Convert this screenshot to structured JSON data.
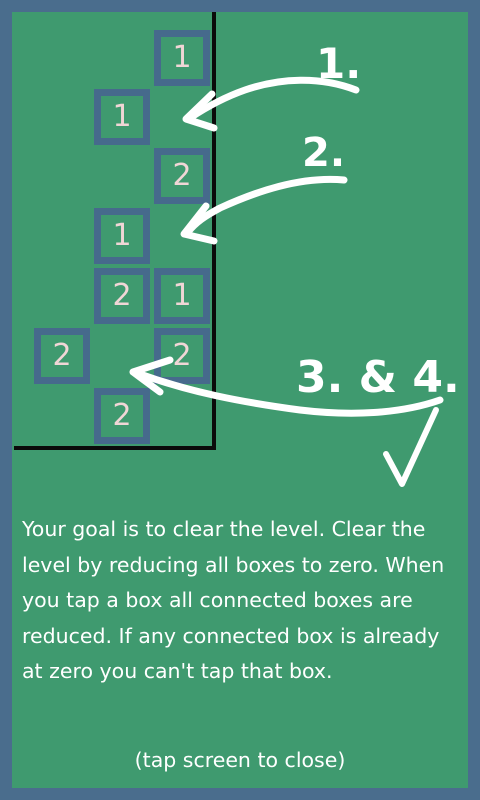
{
  "boxes": [
    {
      "value": "1"
    },
    {
      "value": "1"
    },
    {
      "value": "2"
    },
    {
      "value": "1"
    },
    {
      "value": "2"
    },
    {
      "value": "1"
    },
    {
      "value": "2"
    },
    {
      "value": "2"
    },
    {
      "value": "2"
    }
  ],
  "annotations": {
    "step1": "1.",
    "step2": "2.",
    "step3": "3. & 4.",
    "check": "✓"
  },
  "instructions": {
    "text": "Your goal is to clear the level. Clear the level by reducing all boxes to zero.  When you tap a box all connected boxes are reduced. If any connected box is already at zero you can't tap that box.",
    "close_hint": "(tap screen to close)"
  },
  "colors": {
    "background": "#4a6d8d",
    "board": "#3f9a6f",
    "box_border": "#466a8c",
    "box_text": "#f0d6d6",
    "wall": "#0b0b0b",
    "ink": "#ffffff"
  }
}
